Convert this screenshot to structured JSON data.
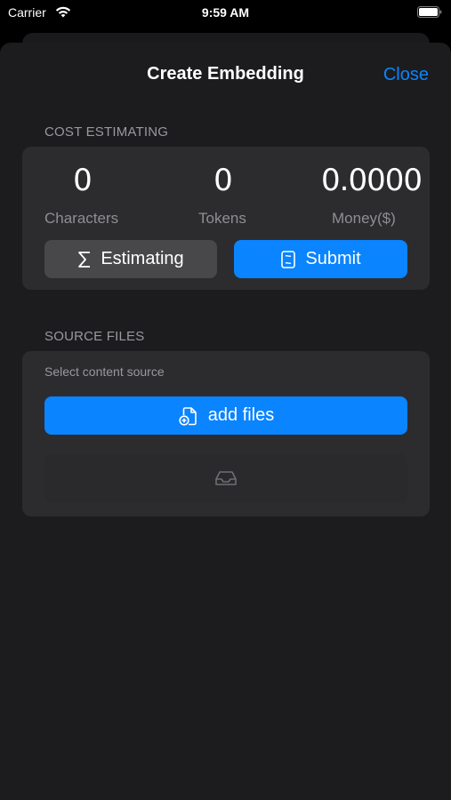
{
  "status_bar": {
    "carrier": "Carrier",
    "time": "9:59 AM"
  },
  "sheet": {
    "title": "Create Embedding",
    "close_label": "Close"
  },
  "cost": {
    "header": "COST ESTIMATING",
    "characters": {
      "value": "0",
      "label": "Characters"
    },
    "tokens": {
      "value": "0",
      "label": "Tokens"
    },
    "money": {
      "value": "0.0000",
      "label": "Money($)"
    },
    "estimate_button": {
      "label": "Estimating",
      "icon": "sigma-icon"
    },
    "submit_button": {
      "label": "Submit",
      "icon": "submit-card-icon"
    }
  },
  "source": {
    "header": "SOURCE FILES",
    "caption": "Select content source",
    "add_button": {
      "label": "add files",
      "icon": "add-document-icon"
    },
    "empty_icon": "tray-icon"
  },
  "colors": {
    "accent": "#0a84ff",
    "sheet_bg": "#1c1c1e",
    "group_bg": "#2c2c2e",
    "secondary_text": "#8e8e93"
  }
}
